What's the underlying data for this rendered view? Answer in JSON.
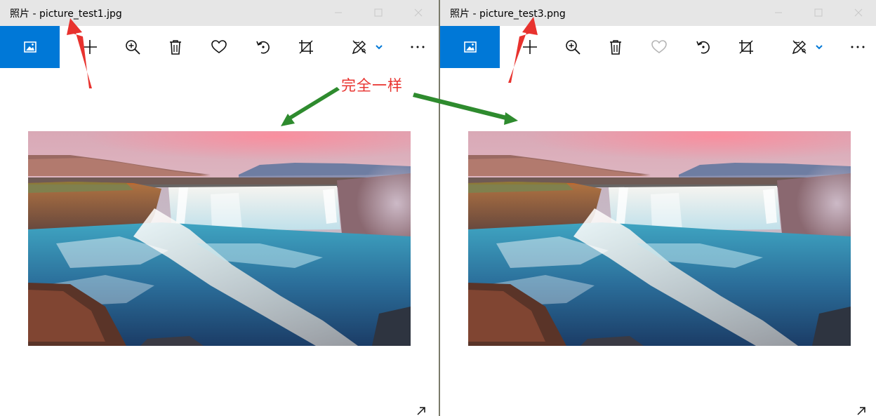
{
  "left_window": {
    "title": "照片 - picture_test1.jpg"
  },
  "right_window": {
    "title": "照片 - picture_test3.png"
  },
  "annotation": {
    "label": "完全一样"
  },
  "icons": {
    "home": "gallery-icon",
    "add": "plus-icon",
    "zoom": "zoom-in-icon",
    "delete": "trash-icon",
    "favorite": "heart-icon",
    "rotate": "rotate-icon",
    "crop": "crop-icon",
    "edit": "edit-draw-icon",
    "dropdown": "chevron-down-icon",
    "more": "more-icon",
    "minimize": "minimize-icon",
    "maximize": "maximize-icon",
    "close": "close-icon",
    "expand": "expand-icon"
  },
  "colors": {
    "accent": "#0078d7",
    "titlebar": "#e6e6e6",
    "annotation_red": "#e8322e",
    "annotation_green": "#2e8b2e"
  }
}
